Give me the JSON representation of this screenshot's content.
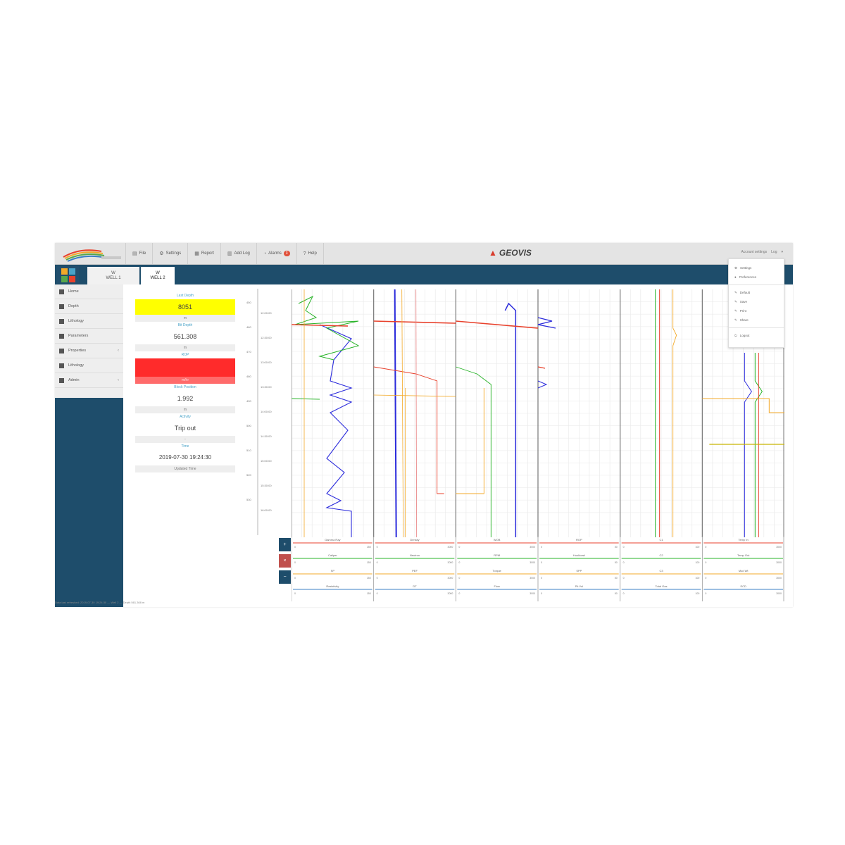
{
  "topbar": {
    "menu": [
      {
        "icon": "file-icon",
        "label": "File"
      },
      {
        "icon": "gear-icon",
        "label": "Settings"
      },
      {
        "icon": "report-icon",
        "label": "Report"
      },
      {
        "icon": "chart-icon",
        "label": "Add Log"
      },
      {
        "icon": "bell-icon",
        "label": "Alarms",
        "badge": "3"
      },
      {
        "icon": "help-icon",
        "label": "Help"
      }
    ],
    "brand": "GEOVIS",
    "user": "Account settings",
    "user_menu_label": "Log"
  },
  "tabs": [
    {
      "label1": "W",
      "label2": "WELL 1"
    },
    {
      "label1": "W",
      "label2": "WELL 2"
    }
  ],
  "sidebar": {
    "items": [
      {
        "label": "Home",
        "icon": "home-icon"
      },
      {
        "label": "Depth",
        "icon": "depth-icon"
      },
      {
        "label": "Lithology",
        "icon": "layers-icon",
        "chevron": false
      },
      {
        "label": "Parameters",
        "icon": "sliders-icon"
      },
      {
        "label": "Properties",
        "icon": "chart-icon",
        "chevron": true
      },
      {
        "label": "Lithology",
        "icon": "layers-icon"
      },
      {
        "label": "Admin",
        "icon": "admin-icon",
        "chevron": true
      }
    ]
  },
  "info": {
    "fields": [
      {
        "label": "Last Depth",
        "value": "8051",
        "unit": "m",
        "color": "#ffff00"
      },
      {
        "label": "Bit Depth",
        "value": "561.308",
        "unit": "m"
      },
      {
        "label": "ROP",
        "value": "",
        "unit": "m/hr",
        "color": "#ff2b2b"
      },
      {
        "label": "Block Position",
        "value": "1.992",
        "unit": "m"
      },
      {
        "label": "Activity",
        "value": "Trip out",
        "unit": "-"
      },
      {
        "label": "Time",
        "value": "2019-07-30 19:24:30",
        "unit": "Updated Time"
      }
    ]
  },
  "depth_ticks": [
    "450",
    "460",
    "470",
    "480",
    "490",
    "500",
    "510",
    "520",
    "530"
  ],
  "depth_labels": [
    "12:00:00",
    "12:30:00",
    "13:00:00",
    "13:30:00",
    "14:00:00",
    "14:30:00",
    "15:00:00",
    "15:30:00",
    "16:00:00"
  ],
  "legend_buttons": [
    "+",
    "×",
    "−"
  ],
  "legend_columns": [
    {
      "names": [
        "Gamma Ray",
        "Caliper",
        "SP",
        "Resistivity"
      ],
      "scale": [
        "0",
        "150"
      ]
    },
    {
      "names": [
        "Density",
        "Neutron",
        "PEF",
        "DT"
      ],
      "scale": [
        "0",
        "3000"
      ]
    },
    {
      "names": [
        "WOB",
        "RPM",
        "Torque",
        "Flow"
      ],
      "scale": [
        "0",
        "3000"
      ]
    },
    {
      "names": [
        "ROP",
        "Hookload",
        "SPP",
        "Pit Vol"
      ],
      "scale": [
        "0",
        "50"
      ]
    },
    {
      "names": [
        "C1",
        "C2",
        "C3",
        "Total Gas"
      ],
      "scale": [
        "0",
        "100"
      ]
    },
    {
      "names": [
        "Temp In",
        "Temp Out",
        "Mud Wt",
        "ECD"
      ],
      "scale": [
        "0",
        "3000"
      ]
    }
  ],
  "dropdown": {
    "items": [
      "Settings",
      "Preferences",
      "Default",
      "Save",
      "Print",
      "Share",
      "Logout"
    ]
  },
  "status": "Data last refreshed: 2019-07-30 19:24:30 — Well 2 — Depth 561.308 m",
  "colors": {
    "accent": "#1e4d6b",
    "warning": "#ffff00",
    "alarm": "#ff2b2b",
    "link": "#4aa3c8"
  }
}
